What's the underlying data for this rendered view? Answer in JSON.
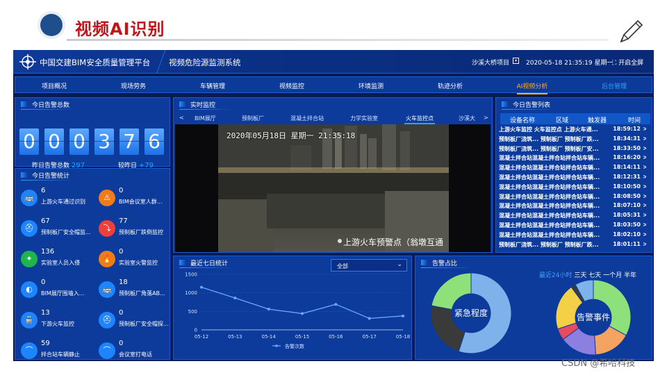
{
  "slide": {
    "title": "视频AI识别",
    "watermark": "CSDN @希哈科技"
  },
  "topbar": {
    "platform_title": "中国交建BIM安全质量管理平台",
    "system_title": "视频危险源监测系统",
    "project": "沙溪大桥项目",
    "datetime": "2020-05-18 21:35:19  星期一",
    "fullscreen": "开启全屏"
  },
  "nav": {
    "items": [
      "项目概况",
      "现场劳务",
      "车辆管理",
      "视频监控",
      "环境监测",
      "轨迹分析",
      "AI视频分析",
      "后台管理"
    ],
    "active": "AI视频分析"
  },
  "alarm_total": {
    "title": "今日告警总数",
    "digits": [
      "0",
      "0",
      "0",
      "3",
      "7",
      "6"
    ],
    "yesterday_label": "昨日告警总数",
    "yesterday_value": "297",
    "compare_label": "较昨日",
    "compare_value": "+79"
  },
  "alarm_stats": {
    "title": "今日告警统计",
    "items": [
      {
        "num": "6",
        "label": "上游火车通过识别",
        "icon": "bus-icon",
        "color": "#1e84ff"
      },
      {
        "num": "0",
        "label": "BIM会议室人群...",
        "icon": "warning-icon",
        "color": "#f07b1a"
      },
      {
        "num": "67",
        "label": "预制板厂安全帽监...",
        "icon": "helmet-icon",
        "color": "#1e84ff"
      },
      {
        "num": "77",
        "label": "预制板厂跌倒监控",
        "icon": "fall-icon",
        "color": "#ee3f3a"
      },
      {
        "num": "136",
        "label": "实验室人员入侵",
        "icon": "intrusion-icon",
        "color": "#1eb54a"
      },
      {
        "num": "0",
        "label": "实验室火警监控",
        "icon": "fire-icon",
        "color": "#f07b1a"
      },
      {
        "num": "0",
        "label": "BIM展厅围墙入...",
        "icon": "fence-icon",
        "color": "#1e84ff"
      },
      {
        "num": "18",
        "label": "预制板厂角落AB...",
        "icon": "bus-icon",
        "color": "#1e84ff"
      },
      {
        "num": "13",
        "label": "下游火车监控",
        "icon": "train-icon",
        "color": "#1e84ff"
      },
      {
        "num": "0",
        "label": "预制板厂安全帽探...",
        "icon": "helmet-icon",
        "color": "#1e84ff"
      },
      {
        "num": "59",
        "label": "拌合站车辆静止",
        "icon": "arch-icon",
        "color": "#1e84ff"
      },
      {
        "num": "0",
        "label": "会议室打电话",
        "icon": "arch-icon",
        "color": "#1e84ff"
      }
    ]
  },
  "live": {
    "title": "实时监控",
    "tabs": [
      "BIM展厅",
      "预制板厂",
      "混凝土拌合站",
      "力学实验室",
      "火车监控点",
      "沙溪大"
    ],
    "active_tab": "火车监控点",
    "prev_arrow": "<",
    "next_arrow": ">",
    "video_timestamp": "2020年05月18日 星期一 21:35:18",
    "video_caption": "上游火车预警点（翁墩互通"
  },
  "alarm_list": {
    "title": "今日告警列表",
    "columns": [
      "设备名称",
      "区域",
      "触发器",
      "时间"
    ],
    "rows": [
      {
        "text": "上游火车监控 火车监控点 上游火车通...",
        "time": "18:59:12"
      },
      {
        "text": "预制板厂浇筑... 预制板厂 预制板厂跌...",
        "time": "18:34:31"
      },
      {
        "text": "预制板厂浇筑... 预制板厂 预制板厂安...",
        "time": "18:33:50"
      },
      {
        "text": "混凝土拌合站混凝土拌合站拌合站车辆...",
        "time": "18:16:20"
      },
      {
        "text": "混凝土拌合站混凝土拌合站拌合站车辆...",
        "time": "18:14:11"
      },
      {
        "text": "混凝土拌合站混凝土拌合站拌合站车辆...",
        "time": "18:12:31"
      },
      {
        "text": "混凝土拌合站混凝土拌合站拌合站车辆...",
        "time": "18:10:50"
      },
      {
        "text": "混凝土拌合站混凝土拌合站拌合站车辆...",
        "time": "18:08:50"
      },
      {
        "text": "混凝土拌合站混凝土拌合站拌合站车辆...",
        "time": "18:07:10"
      },
      {
        "text": "混凝土拌合站混凝土拌合站拌合站车辆...",
        "time": "18:05:31"
      },
      {
        "text": "混凝土拌合站混凝土拌合站拌合站车辆...",
        "time": "18:03:50"
      },
      {
        "text": "混凝土拌合站混凝土拌合站拌合站车辆...",
        "time": "18:02:10"
      },
      {
        "text": "预制板厂浇筑... 预制板厂 预制板厂跌...",
        "time": "18:01:11"
      }
    ]
  },
  "seven_day": {
    "title": "最近七日统计",
    "select_value": "全部",
    "chart_data": {
      "type": "line",
      "x": [
        "05-12",
        "05-13",
        "05-14",
        "05-15",
        "05-16",
        "05-17",
        "05-18"
      ],
      "series": [
        {
          "name": "告警次数",
          "values": [
            1150,
            860,
            560,
            440,
            690,
            310,
            376
          ]
        }
      ],
      "yticks": [
        "0",
        "500",
        "1000",
        "1500"
      ],
      "ylim": [
        0,
        1500
      ],
      "grid": true,
      "legend": "bottom",
      "color": "#6aa8ff"
    }
  },
  "alarm_ratio": {
    "title": "告警占比",
    "range_options": [
      "最近24小时",
      "三天",
      "七天",
      "一个月",
      "半年"
    ],
    "active_range": "最近24小时",
    "donuts": [
      {
        "label": "紧急程度",
        "chart_data": {
          "type": "pie",
          "values": [
            55,
            23,
            22
          ],
          "colors": [
            "#7fb2ea",
            "#3a3a3a",
            "#8ee07a"
          ]
        }
      },
      {
        "label": "告警事件",
        "chart_data": {
          "type": "pie",
          "values": [
            33,
            16,
            16,
            5,
            20,
            2,
            8
          ],
          "colors": [
            "#8ee07a",
            "#f4a460",
            "#8b7fe0",
            "#e84a5f",
            "#f3d046",
            "#3a3a3a",
            "#7fb2ea"
          ]
        }
      }
    ]
  }
}
